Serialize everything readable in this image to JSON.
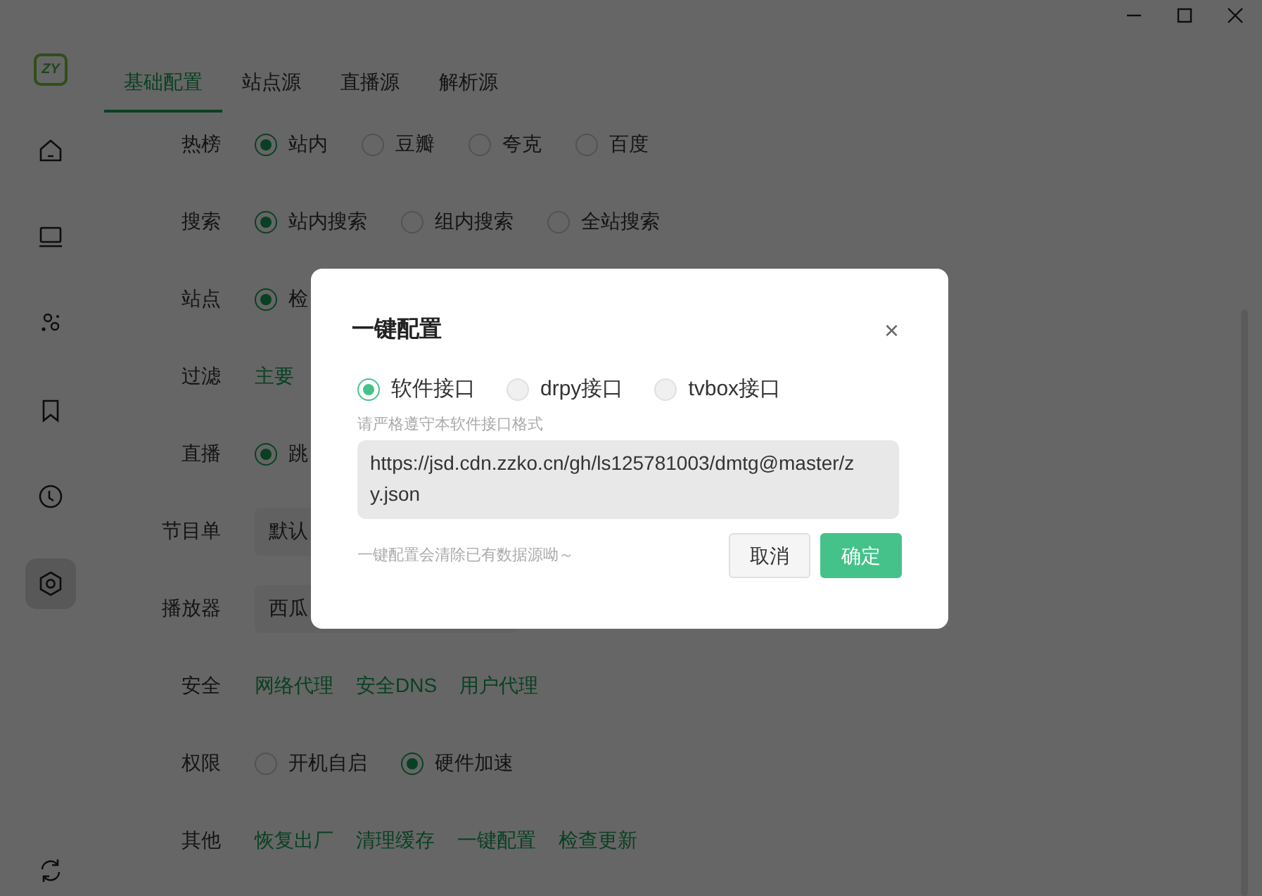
{
  "logo": "ZY",
  "sidebar": {
    "items": [
      {
        "kind": "home",
        "selected": false
      },
      {
        "kind": "screen",
        "selected": false
      },
      {
        "kind": "nodes",
        "selected": false
      },
      {
        "kind": "bookmark",
        "selected": false
      },
      {
        "kind": "history",
        "selected": false
      },
      {
        "kind": "settings",
        "selected": true
      },
      {
        "kind": "refresh",
        "selected": false
      }
    ]
  },
  "tabs": [
    {
      "label": "基础配置",
      "selected": true
    },
    {
      "label": "站点源",
      "selected": false
    },
    {
      "label": "直播源",
      "selected": false
    },
    {
      "label": "解析源",
      "selected": false
    }
  ],
  "settings": [
    {
      "label": "热榜",
      "kind": "radio",
      "options": [
        {
          "label": "站内",
          "selected": true
        },
        {
          "label": "豆瓣",
          "selected": false
        },
        {
          "label": "夸克",
          "selected": false
        },
        {
          "label": "百度",
          "selected": false
        }
      ]
    },
    {
      "label": "搜索",
      "kind": "radio",
      "options": [
        {
          "label": "站内搜索",
          "selected": true
        },
        {
          "label": "组内搜索",
          "selected": false
        },
        {
          "label": "全站搜索",
          "selected": false
        }
      ]
    },
    {
      "label": "站点",
      "kind": "radio",
      "options": [
        {
          "label": "检",
          "selected": true
        }
      ]
    },
    {
      "label": "过滤",
      "kind": "links",
      "links": [
        "主要"
      ]
    },
    {
      "label": "直播",
      "kind": "radio",
      "options": [
        {
          "label": "跳",
          "selected": true
        }
      ]
    },
    {
      "label": "节目单",
      "kind": "select",
      "value": "默认"
    },
    {
      "label": "播放器",
      "kind": "select",
      "value": "西瓜"
    },
    {
      "label": "安全",
      "kind": "links",
      "links": [
        "网络代理",
        "安全DNS",
        "用户代理"
      ]
    },
    {
      "label": "权限",
      "kind": "radio",
      "options": [
        {
          "label": "开机自启",
          "selected": false
        },
        {
          "label": "硬件加速",
          "selected": true
        }
      ]
    },
    {
      "label": "其他",
      "kind": "links",
      "links": [
        "恢复出厂",
        "清理缓存",
        "一键配置",
        "检查更新"
      ]
    }
  ],
  "dialog": {
    "title": "一键配置",
    "close": "×",
    "options": [
      {
        "label": "软件接口",
        "selected": true
      },
      {
        "label": "drpy接口",
        "selected": false
      },
      {
        "label": "tvbox接口",
        "selected": false
      }
    ],
    "hint": "请严格遵守本软件接口格式",
    "value": "https://jsd.cdn.zzko.cn/gh/ls125781003/dmtg@master/zy.json",
    "note": "一键配置会清除已有数据源呦～",
    "buttons": [
      {
        "label": "取消",
        "kind": "secondary"
      },
      {
        "label": "确定",
        "kind": "primary"
      }
    ]
  }
}
